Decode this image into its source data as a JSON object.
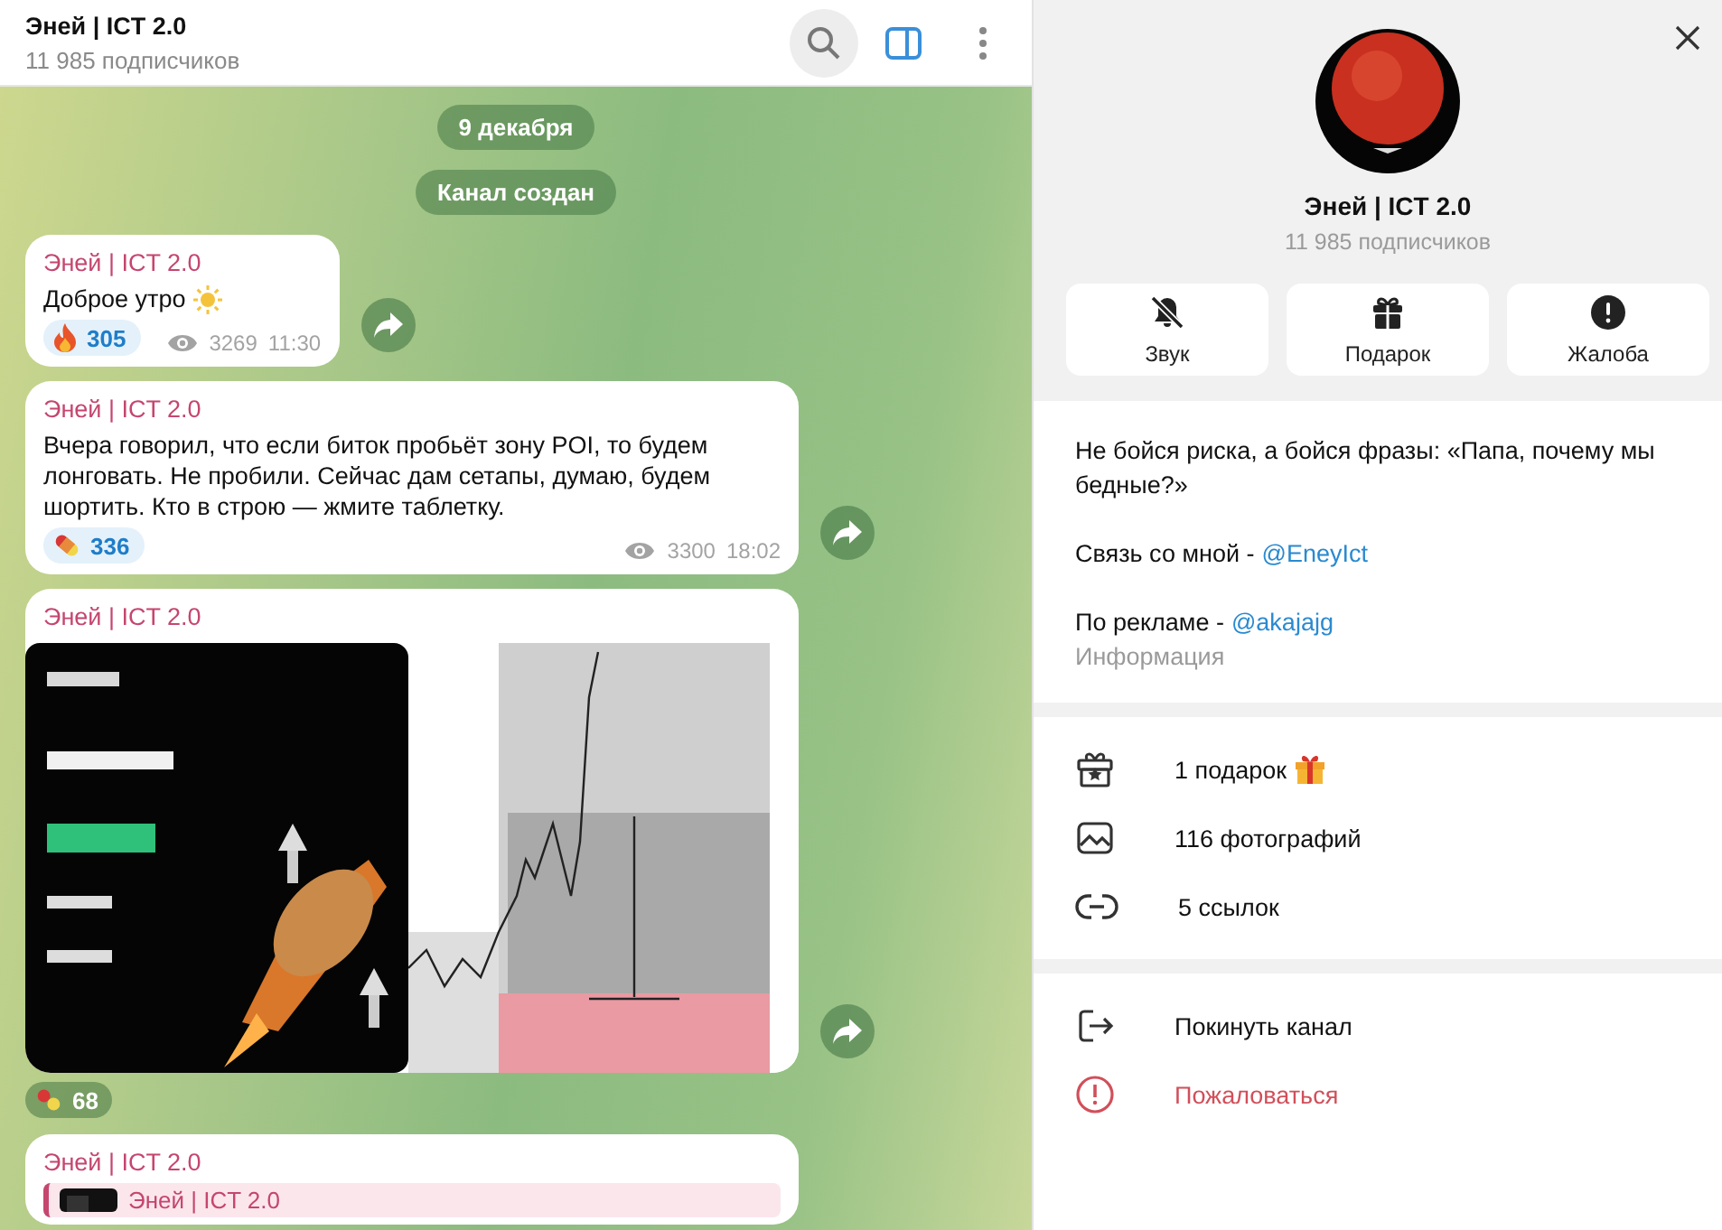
{
  "header": {
    "title": "Эней | ICT 2.0",
    "subtitle": "11 985 подписчиков"
  },
  "service": [
    {
      "text": "9 декабря"
    },
    {
      "text": "Канал создан"
    }
  ],
  "messages": [
    {
      "kind": "text",
      "author": "Эней | ICT 2.0",
      "text": "Доброе утро",
      "sun": true,
      "reactions": [
        {
          "kind": "fire",
          "count": "305"
        }
      ],
      "views": "3269",
      "time": "11:30"
    },
    {
      "kind": "text",
      "author": "Эней | ICT 2.0",
      "text": "Вчера говорил, что если биток пробьёт зону POI, то будем лонговать. Не пробили. Сейчас дам сетапы, думаю, будем шортить. Кто в строю — жмите таблетку.",
      "sun": false,
      "reactions": [
        {
          "kind": "pill",
          "count": "336"
        }
      ],
      "views": "3300",
      "time": "18:02"
    },
    {
      "author": "Эней | ICT 2.0",
      "reactions": [
        {
          "kind": "pill",
          "count": "68"
        }
      ]
    },
    {
      "kind": "reply",
      "author": "Эней | ICT 2.0",
      "reply_author": "Эней | ICT 2.0"
    }
  ],
  "profile": {
    "title": "Эней | ICT 2.0",
    "subtitle": "11 985 подписчиков",
    "actions": [
      {
        "kind": "mute",
        "label": "Звук"
      },
      {
        "kind": "gift",
        "label": "Подарок"
      },
      {
        "kind": "alert",
        "label": "Жалоба"
      }
    ],
    "bio": {
      "text": "Не бойся риска, а бойся фразы: «Папа, почему мы бедные?»",
      "contacts": [
        {
          "label": "Связь со мной -",
          "link": "@EneyIct"
        },
        {
          "label": "По рекламе -",
          "link": "@akajajg"
        }
      ],
      "caption": "Информация"
    },
    "media": [
      {
        "kind": "gift",
        "label": "1 подарок",
        "emoji": true
      },
      {
        "label": "116 фотографий",
        "emoji": false
      },
      {
        "kind": "link",
        "label": "5 ссылок",
        "emoji": false
      }
    ],
    "commands": [
      {
        "kind": "leave",
        "label": "Покинуть канал",
        "danger": false
      },
      {
        "kind": "report",
        "label": "Пожаловаться",
        "danger": true
      }
    ]
  }
}
